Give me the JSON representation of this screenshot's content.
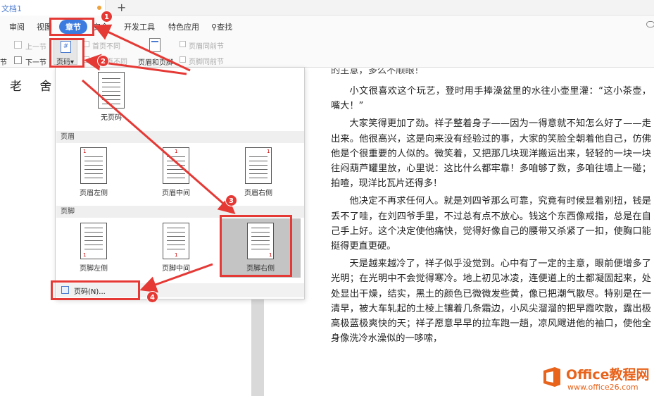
{
  "titlebar": {
    "doc_name": "文档1",
    "new_tab": "+"
  },
  "ribbon_tabs": [
    {
      "label": "审阅"
    },
    {
      "label": "视图"
    },
    {
      "label": "章节",
      "active": true
    },
    {
      "label": "安全"
    },
    {
      "label": "开发工具"
    },
    {
      "label": "特色应用"
    },
    {
      "label": "查找"
    }
  ],
  "ribbon_tools": {
    "prev_section": "上一节",
    "next_section": "下一节",
    "section_left": "节",
    "first_page_diff": "首页不同",
    "odd_even_diff": "奇偶页不同",
    "page_number": "页码",
    "page_number_glyph": "#",
    "header_footer": "页眉和页脚",
    "header_same_prev": "页眉同前节",
    "footer_same_prev": "页脚同前节"
  },
  "dropdown": {
    "no_page": "无页码",
    "header_section": "页眉",
    "footer_section": "页脚",
    "header_options": [
      "页眉左侧",
      "页眉中间",
      "页眉右侧"
    ],
    "footer_options": [
      "页脚左侧",
      "页脚中间",
      "页脚右侧"
    ],
    "page_number_item": "页码(N)...",
    "sample_number": "1"
  },
  "document": {
    "author": "老 舍",
    "cut_line": "的主意，多么不顺眼！",
    "paragraphs": [
      "小文很喜欢这个玩艺，登时用手捧澡盆里的水往小壶里灌：“这小茶壶，嘴大！”",
      "大家笑得更加了劲。祥子整着身子——因为一得意就不知怎么好了——走出来。他很高兴，这是向来没有经验过的事，大家的笑脸全朝着他自己，仿佛他是个很重要的人似的。微笑着，又把那几块现洋搬运出来，轻轻的一块一块往闷葫芦罐里放，心里说：这比什么都牢靠！多咱够了数，多咱往墙上一碰；拍喳，现洋比瓦片还得多！",
      "他决定不再求任何人。就是刘四爷那么可靠，究竟有时候显着别扭，钱是丢不了哇，在刘四爷手里，不过总有点不放心。钱这个东西像戒指，总是在自己手上好。这个决定使他痛快，觉得好像自己的腰带又杀紧了一扣，使胸口能挺得更直更硬。",
      "天是越来越冷了，祥子似乎没觉到。心中有了一定的主意，眼前便增多了光明；在光明中不会觉得寒冷。地上初见冰凌，连便道上的土都凝固起来，处处显出干燥，结实，黑土的颜色已微微发些黄，像已把潮气散尽。特别是在一清早，被大车轧起的土棱上镶着几条霜边，小风尖溜溜的把早霞吹散，露出极高极蓝极爽快的天；祥子愿意早早的拉车跑一趟，凉风飕进他的袖口，使他全身像洗冷水澡似的一哆嗦，"
    ]
  },
  "annotations": {
    "badges": [
      "1",
      "2",
      "3",
      "4"
    ],
    "color": "#e53935"
  },
  "watermark": {
    "brand": "Office教程网",
    "url": "www.office26.com"
  },
  "colors": {
    "accent": "#3b7be0",
    "annotation": "#e53935",
    "brand": "#e8631b"
  }
}
